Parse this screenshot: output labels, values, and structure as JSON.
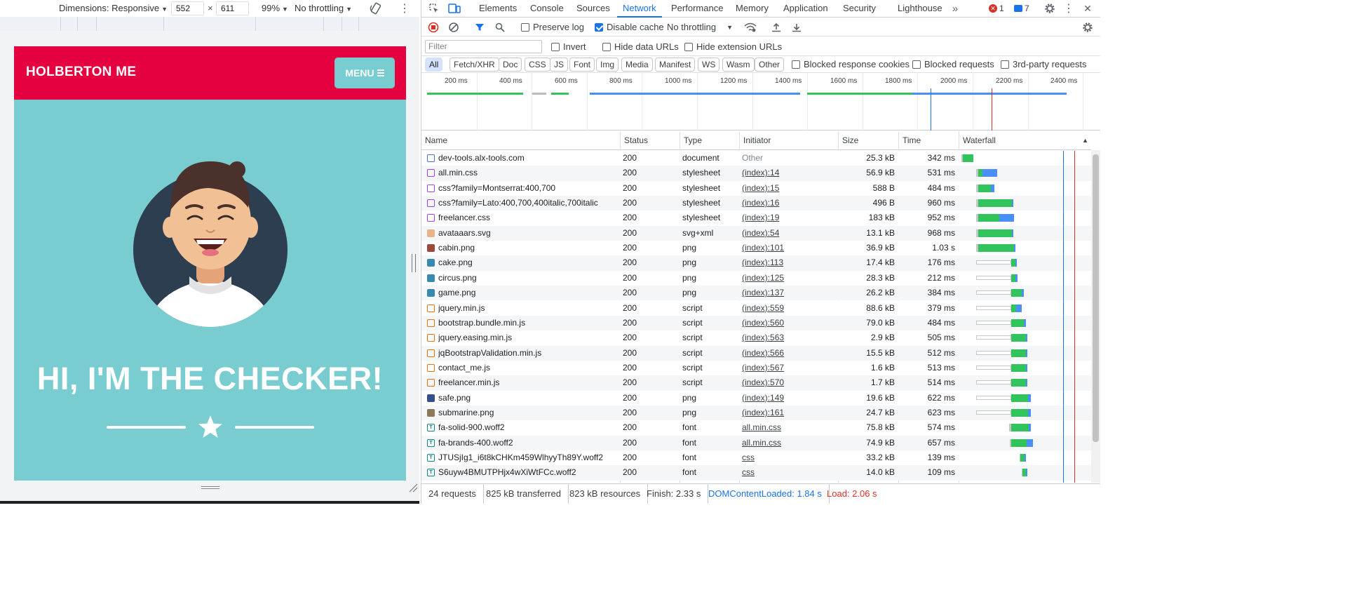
{
  "device_toolbar": {
    "dimensions_label": "Dimensions: Responsive",
    "width": "552",
    "times": "×",
    "height": "611",
    "zoom": "99%",
    "throttle": "No throttling"
  },
  "site": {
    "brand": "HOLBERTON ME",
    "menu_label": "MENU",
    "hero_title": "HI, I'M THE CHECKER!"
  },
  "devtools": {
    "tabs": [
      "Elements",
      "Console",
      "Sources",
      "Network",
      "Performance",
      "Memory",
      "Application",
      "Security",
      "Lighthouse"
    ],
    "active_tab": "Network",
    "error_count": "1",
    "message_count": "7",
    "preserve_log": "Preserve log",
    "disable_cache": "Disable cache",
    "throttle": "No throttling",
    "filter_placeholder": "Filter",
    "invert": "Invert",
    "hide_data_urls": "Hide data URLs",
    "hide_extension_urls": "Hide extension URLs",
    "type_filters": [
      "All",
      "Fetch/XHR",
      "Doc",
      "CSS",
      "JS",
      "Font",
      "Img",
      "Media",
      "Manifest",
      "WS",
      "Wasm",
      "Other"
    ],
    "blocked_cookies": "Blocked response cookies",
    "blocked_requests": "Blocked requests",
    "third_party": "3rd-party requests",
    "timeline_ticks": [
      "200 ms",
      "400 ms",
      "600 ms",
      "800 ms",
      "1000 ms",
      "1200 ms",
      "1400 ms",
      "1600 ms",
      "1800 ms",
      "2000 ms",
      "2200 ms",
      "2400 ms"
    ],
    "columns": [
      "Name",
      "Status",
      "Type",
      "Initiator",
      "Size",
      "Time",
      "Waterfall"
    ],
    "requests": [
      {
        "icon": "doc",
        "name": "dev-tools.alx-tools.com",
        "status": "200",
        "type": "document",
        "initiator": "Other",
        "size": "25.3 kB",
        "time": "342 ms",
        "start": 0,
        "wait": 0.01,
        "dl": 0.1,
        "blue": 0
      },
      {
        "icon": "css",
        "name": "all.min.css",
        "status": "200",
        "type": "stylesheet",
        "initiator": "(index):14",
        "size": "56.9 kB",
        "time": "531 ms",
        "start": 0.14,
        "wait": 0.02,
        "dl": 0.04,
        "blue": 0.14
      },
      {
        "icon": "css",
        "name": "css?family=Montserrat:400,700",
        "status": "200",
        "type": "stylesheet",
        "initiator": "(index):15",
        "size": "588 B",
        "time": "484 ms",
        "start": 0.14,
        "wait": 0.02,
        "dl": 0.12,
        "blue": 0.03
      },
      {
        "icon": "css",
        "name": "css?family=Lato:400,700,400italic,700italic",
        "status": "200",
        "type": "stylesheet",
        "initiator": "(index):16",
        "size": "496 B",
        "time": "960 ms",
        "start": 0.14,
        "wait": 0.02,
        "dl": 0.32,
        "blue": 0.01
      },
      {
        "icon": "css",
        "name": "freelancer.css",
        "status": "200",
        "type": "stylesheet",
        "initiator": "(index):19",
        "size": "183 kB",
        "time": "952 ms",
        "start": 0.14,
        "wait": 0.02,
        "dl": 0.2,
        "blue": 0.14
      },
      {
        "icon": "img-avatar",
        "name": "avataaars.svg",
        "status": "200",
        "type": "svg+xml",
        "initiator": "(index):54",
        "size": "13.1 kB",
        "time": "968 ms",
        "start": 0.14,
        "wait": 0.02,
        "dl": 0.32,
        "blue": 0.01
      },
      {
        "icon": "img",
        "name": "cabin.png",
        "status": "200",
        "type": "png",
        "initiator": "(index):101",
        "size": "36.9 kB",
        "time": "1.03 s",
        "start": 0.14,
        "wait": 0.02,
        "dl": 0.34,
        "blue": 0.01
      },
      {
        "icon": "img",
        "name": "cake.png",
        "status": "200",
        "type": "png",
        "initiator": "(index):113",
        "size": "17.4 kB",
        "time": "176 ms",
        "start": 0.14,
        "wait": 0.33,
        "dl": 0.04,
        "blue": 0.01
      },
      {
        "icon": "img",
        "name": "circus.png",
        "status": "200",
        "type": "png",
        "initiator": "(index):125",
        "size": "28.3 kB",
        "time": "212 ms",
        "start": 0.14,
        "wait": 0.33,
        "dl": 0.04,
        "blue": 0.02
      },
      {
        "icon": "img",
        "name": "game.png",
        "status": "200",
        "type": "png",
        "initiator": "(index):137",
        "size": "26.2 kB",
        "time": "384 ms",
        "start": 0.14,
        "wait": 0.33,
        "dl": 0.1,
        "blue": 0.02
      },
      {
        "icon": "js",
        "name": "jquery.min.js",
        "status": "200",
        "type": "script",
        "initiator": "(index):559",
        "size": "88.6 kB",
        "time": "379 ms",
        "start": 0.14,
        "wait": 0.33,
        "dl": 0.05,
        "blue": 0.05
      },
      {
        "icon": "js",
        "name": "bootstrap.bundle.min.js",
        "status": "200",
        "type": "script",
        "initiator": "(index):560",
        "size": "79.0 kB",
        "time": "484 ms",
        "start": 0.14,
        "wait": 0.33,
        "dl": 0.12,
        "blue": 0.02
      },
      {
        "icon": "js",
        "name": "jquery.easing.min.js",
        "status": "200",
        "type": "script",
        "initiator": "(index):563",
        "size": "2.9 kB",
        "time": "505 ms",
        "start": 0.14,
        "wait": 0.33,
        "dl": 0.14,
        "blue": 0.01
      },
      {
        "icon": "js",
        "name": "jqBootstrapValidation.min.js",
        "status": "200",
        "type": "script",
        "initiator": "(index):566",
        "size": "15.5 kB",
        "time": "512 ms",
        "start": 0.14,
        "wait": 0.33,
        "dl": 0.14,
        "blue": 0.01
      },
      {
        "icon": "js",
        "name": "contact_me.js",
        "status": "200",
        "type": "script",
        "initiator": "(index):567",
        "size": "1.6 kB",
        "time": "513 ms",
        "start": 0.14,
        "wait": 0.33,
        "dl": 0.14,
        "blue": 0.01
      },
      {
        "icon": "js",
        "name": "freelancer.min.js",
        "status": "200",
        "type": "script",
        "initiator": "(index):570",
        "size": "1.7 kB",
        "time": "514 ms",
        "start": 0.14,
        "wait": 0.33,
        "dl": 0.14,
        "blue": 0.01
      },
      {
        "icon": "img-safe",
        "name": "safe.png",
        "status": "200",
        "type": "png",
        "initiator": "(index):149",
        "size": "19.6 kB",
        "time": "622 ms",
        "start": 0.14,
        "wait": 0.33,
        "dl": 0.16,
        "blue": 0.03
      },
      {
        "icon": "img-sub",
        "name": "submarine.png",
        "status": "200",
        "type": "png",
        "initiator": "(index):161",
        "size": "24.7 kB",
        "time": "623 ms",
        "start": 0.14,
        "wait": 0.33,
        "dl": 0.16,
        "blue": 0.03
      },
      {
        "icon": "font",
        "name": "fa-solid-900.woff2",
        "status": "200",
        "type": "font",
        "initiator": "all.min.css",
        "size": "75.8 kB",
        "time": "574 ms",
        "start": 0.45,
        "wait": 0.02,
        "dl": 0.17,
        "blue": 0.02
      },
      {
        "icon": "font",
        "name": "fa-brands-400.woff2",
        "status": "200",
        "type": "font",
        "initiator": "all.min.css",
        "size": "74.9 kB",
        "time": "657 ms",
        "start": 0.46,
        "wait": 0.01,
        "dl": 0.15,
        "blue": 0.06
      },
      {
        "icon": "font",
        "name": "JTUSjIg1_i6t8kCHKm459WlhyyTh89Y.woff2",
        "status": "200",
        "type": "font",
        "initiator": "css",
        "size": "33.2 kB",
        "time": "139 ms",
        "start": 0.55,
        "wait": 0.01,
        "dl": 0.04,
        "blue": 0.01
      },
      {
        "icon": "font",
        "name": "S6uyw4BMUTPHjx4wXiWtFCc.woff2",
        "status": "200",
        "type": "font",
        "initiator": "css",
        "size": "14.0 kB",
        "time": "109 ms",
        "start": 0.57,
        "wait": 0.01,
        "dl": 0.03,
        "blue": 0.01
      }
    ],
    "status_bar": {
      "requests": "24 requests",
      "transferred": "825 kB transferred",
      "resources": "823 kB resources",
      "finish": "Finish: 2.33 s",
      "dom_content_loaded": "DOMContentLoaded: 1.84 s",
      "load": "Load: 2.06 s"
    }
  },
  "colors": {
    "nav_red": "#e5003f",
    "teal": "#79cdd1",
    "devtools_blue": "#1a73e8",
    "waterfall_green": "#31c35c",
    "waterfall_blue": "#4a8ff7"
  }
}
